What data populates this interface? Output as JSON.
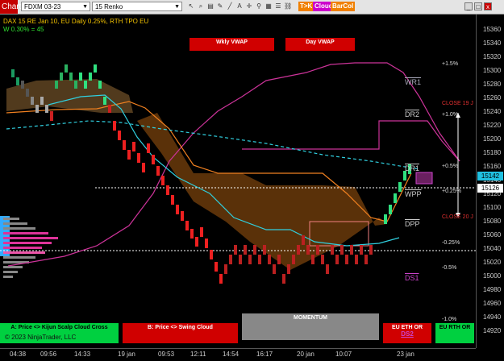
{
  "toolbar": {
    "title": "Chart",
    "instrument": "FDXM 03-23",
    "bar_type": "15 Renko",
    "tags": [
      "T>K",
      "Cloud",
      "BarCol"
    ],
    "tag_colors": [
      "#f08000",
      "#cc00cc",
      "#f08000"
    ]
  },
  "info": {
    "line1": "DAX 15  RE Jan 10, EU Daily 0.25%, RTH TPO EU",
    "line2": "W 0.30% = 45"
  },
  "vwap_boxes": [
    "Wkly VWAP",
    "Day VWAP"
  ],
  "levels": [
    "WR1",
    "DR2",
    "DR1",
    "WPP",
    "DPP",
    "DS1"
  ],
  "percent_labels": [
    "+1.5%",
    "+1.0%",
    "+0.5%",
    "+0.25%",
    "-0.25%",
    "-0.5%",
    "-1.0%"
  ],
  "close_labels": [
    "CLOSE 19 J",
    "CLOSE 20 J"
  ],
  "yaxis": {
    "ticks": [
      "15360",
      "15340",
      "15320",
      "15300",
      "15280",
      "15260",
      "15240",
      "15220",
      "15200",
      "15180",
      "15160",
      "15140",
      "15120",
      "15100",
      "15080",
      "15060",
      "15040",
      "15020",
      "15000",
      "14980",
      "14960",
      "14940",
      "14920"
    ],
    "current_price": "15142",
    "line_price": "15126"
  },
  "xaxis": {
    "ticks": [
      "04:38",
      "09:56",
      "14:33",
      "19 jan",
      "09:53",
      "12:11",
      "14:54",
      "16:17",
      "20 jan",
      "10:07",
      "23 jan"
    ]
  },
  "panels": {
    "left": "A: Price <> Kijun Scalp Cloud Cross",
    "copyright": "© 2023 NinjaTrader, LLC",
    "middle": "B: Price <> Swing Cloud",
    "momentum": "MOMENTUM",
    "eu_or": "EU ETH OR",
    "eu_or_sub": "DS2",
    "eu_rth": "EU RTH OR"
  }
}
